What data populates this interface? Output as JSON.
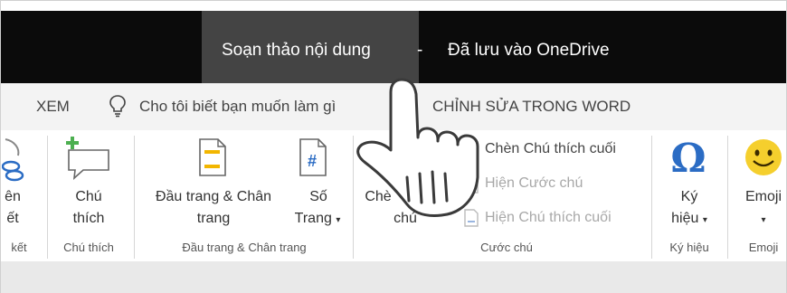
{
  "titlebar": {
    "document": "Soạn thảo nội dung",
    "separator": "-",
    "status": "Đã lưu vào OneDrive"
  },
  "tabs": {
    "view": "XEM",
    "tell_me": "Cho tôi biết bạn muốn làm gì",
    "edit_in_word": "CHỈNH SỬA TRONG WORD"
  },
  "ribbon": {
    "links": {
      "label_line1": "ên",
      "label_line2": "ết",
      "group": "kết"
    },
    "comments": {
      "label_line1": "Chú",
      "label_line2": "thích",
      "group": "Chú thích"
    },
    "header_footer": {
      "hf_label_line1": "Đầu trang & Chân",
      "hf_label_line2": "trang",
      "page_number_line1": "Số",
      "page_number_line2": "Trang",
      "page_number_glyph": "#",
      "group": "Đầu trang & Chân trang"
    },
    "footnotes": {
      "insert_line1": "Chè",
      "insert_line2": "chú",
      "insert_endnote": "Chèn Chú thích cuối",
      "show_footnotes": "Hiện Cước chú",
      "show_endnotes": "Hiện Chú thích cuối",
      "group": "Cước chú"
    },
    "symbols": {
      "glyph": "Ω",
      "label_line1": "Ký",
      "label_line2": "hiệu",
      "group": "Ký hiệu"
    },
    "emoji": {
      "label": "Emoji",
      "group": "Emoji"
    },
    "dropdown_caret": "▾"
  },
  "colors": {
    "titlebar_bg": "#0b0b0b",
    "doc_tab_bg": "#444444",
    "tab_row_bg": "#f3f3f3",
    "accent_blue": "#2b6cc4",
    "accent_green": "#4caf50",
    "accent_yellow": "#f2b600",
    "emoji_yellow": "#f5cf2d"
  }
}
